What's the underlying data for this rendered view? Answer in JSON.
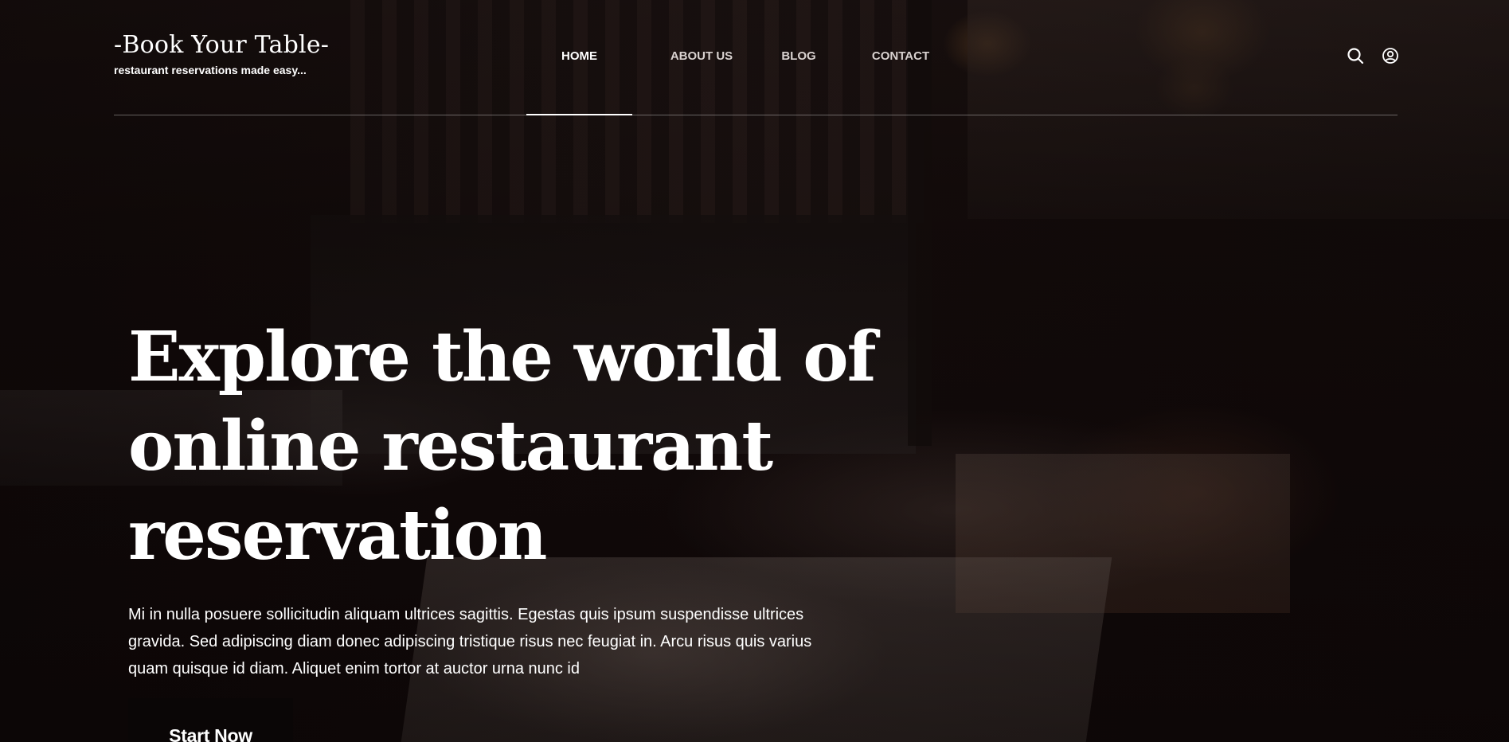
{
  "brand": {
    "title": "-Book Your Table-",
    "tagline": "restaurant reservations made easy..."
  },
  "nav": {
    "items": [
      {
        "label": "HOME",
        "active": true
      },
      {
        "label": "ABOUT US",
        "active": false
      },
      {
        "label": "BLOG",
        "active": false
      },
      {
        "label": "CONTACT",
        "active": false
      }
    ]
  },
  "header_icons": [
    "search-icon",
    "user-account-icon"
  ],
  "hero": {
    "heading_lines": [
      "Explore the world of",
      "online restaurant",
      "reservation"
    ],
    "description": "Mi in nulla posuere sollicitudin aliquam ultrices sagittis. Egestas quis ipsum suspendisse ultrices gravida. Sed adipiscing diam donec adipiscing tristique risus nec feugiat in. Arcu risus quis varius quam quisque id diam. Aliquet enim tortor at auctor urna nunc id",
    "cta_label": "Start Now"
  },
  "colors": {
    "text": "#ffffff",
    "nav_inactive": "#d9d2d0",
    "background": "#120a0a",
    "button_bg": "#0a0606"
  }
}
